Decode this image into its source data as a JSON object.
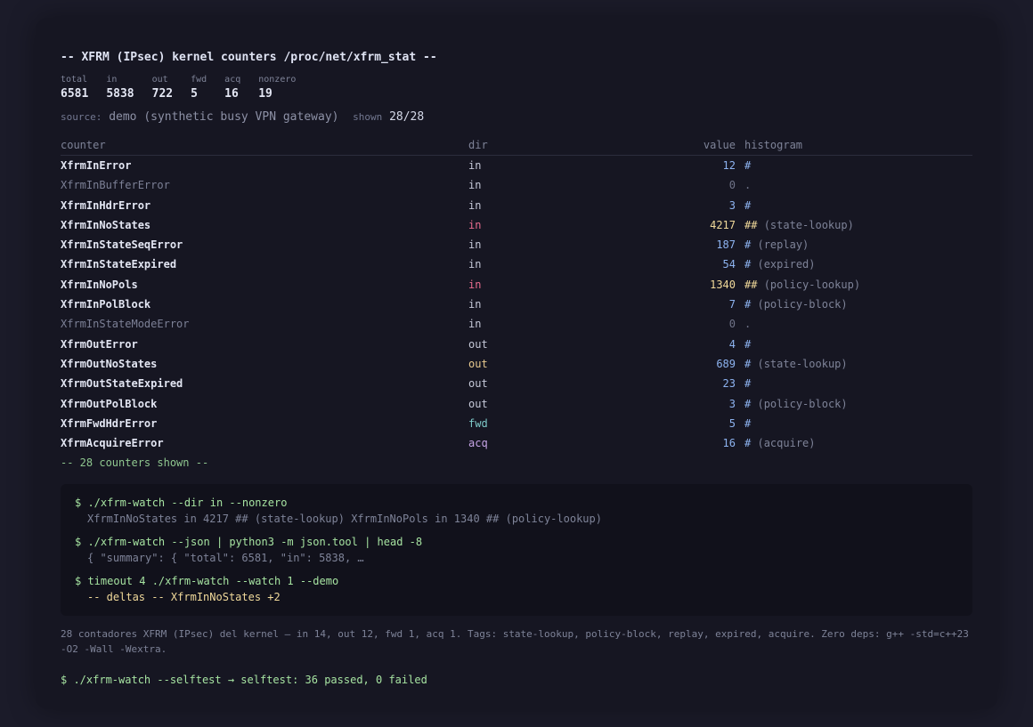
{
  "title": "-- XFRM (IPsec) kernel counters /proc/net/xfrm_stat --",
  "stats": [
    {
      "label": "total",
      "value": "6581"
    },
    {
      "label": "in",
      "value": "5838"
    },
    {
      "label": "out",
      "value": "722"
    },
    {
      "label": "fwd",
      "value": "5"
    },
    {
      "label": "acq",
      "value": "16"
    },
    {
      "label": "nonzero",
      "value": "19"
    }
  ],
  "source": {
    "label": "source:",
    "value": "demo (synthetic busy VPN gateway)",
    "shown_label": "shown",
    "shown_value": "28/28"
  },
  "table": {
    "headers": {
      "counter": "counter",
      "dir": "dir",
      "value": "value",
      "histogram": "histogram"
    },
    "rows": [
      {
        "name": "XfrmInError",
        "dir": "in",
        "value": "12",
        "bar": "#",
        "tag": ""
      },
      {
        "name": "XfrmInBufferError",
        "dir": "in",
        "value": "0",
        "bar": ".",
        "tag": ""
      },
      {
        "name": "XfrmInHdrError",
        "dir": "in",
        "value": "3",
        "bar": "#",
        "tag": ""
      },
      {
        "name": "XfrmInNoStates",
        "dir": "in",
        "value": "4217",
        "bar": "##",
        "tag": "(state-lookup)"
      },
      {
        "name": "XfrmInStateSeqError",
        "dir": "in",
        "value": "187",
        "bar": "#",
        "tag": "(replay)"
      },
      {
        "name": "XfrmInStateExpired",
        "dir": "in",
        "value": "54",
        "bar": "#",
        "tag": "(expired)"
      },
      {
        "name": "XfrmInNoPols",
        "dir": "in",
        "value": "1340",
        "bar": "##",
        "tag": "(policy-lookup)"
      },
      {
        "name": "XfrmInPolBlock",
        "dir": "in",
        "value": "7",
        "bar": "#",
        "tag": "(policy-block)"
      },
      {
        "name": "XfrmInStateModeError",
        "dir": "in",
        "value": "0",
        "bar": ".",
        "tag": ""
      },
      {
        "name": "XfrmOutError",
        "dir": "out",
        "value": "4",
        "bar": "#",
        "tag": ""
      },
      {
        "name": "XfrmOutNoStates",
        "dir": "out",
        "value": "689",
        "bar": "#",
        "tag": "(state-lookup)"
      },
      {
        "name": "XfrmOutStateExpired",
        "dir": "out",
        "value": "23",
        "bar": "#",
        "tag": ""
      },
      {
        "name": "XfrmOutPolBlock",
        "dir": "out",
        "value": "3",
        "bar": "#",
        "tag": "(policy-block)"
      },
      {
        "name": "XfrmFwdHdrError",
        "dir": "fwd",
        "value": "5",
        "bar": "#",
        "tag": ""
      },
      {
        "name": "XfrmAcquireError",
        "dir": "acq",
        "value": "16",
        "bar": "#",
        "tag": "(acquire)"
      }
    ],
    "footer": "-- 28 counters shown --"
  },
  "console": {
    "entries": [
      {
        "cmd": "$ ./xfrm-watch --dir in --nonzero",
        "out": "XfrmInNoStates in 4217 ## (state-lookup) XfrmInNoPols in 1340 ## (policy-lookup)"
      },
      {
        "cmd": "$ ./xfrm-watch --json | python3 -m json.tool | head -8",
        "out": "{ \"summary\": { \"total\": 6581, \"in\": 5838, …"
      },
      {
        "cmd": "$ timeout 4 ./xfrm-watch --watch 1 --demo",
        "out": "-- deltas -- XfrmInNoStates +2"
      }
    ]
  },
  "note": "28 contadores XFRM (IPsec) del kernel — in 14, out 12, fwd 1, acq 1. Tags: state-lookup, policy-block, replay, expired, acquire. Zero deps: g++ -std=c++23 -O2 -Wall -Wextra.",
  "selftest": "$ ./xfrm-watch --selftest → selftest: 36 passed, 0 failed",
  "colors": {
    "background": "#1b1b29",
    "panel": "#161622",
    "hot": "#e86c8e",
    "warm": "#f0d99a",
    "blue": "#8db3f0",
    "green": "#a6e3a1"
  }
}
